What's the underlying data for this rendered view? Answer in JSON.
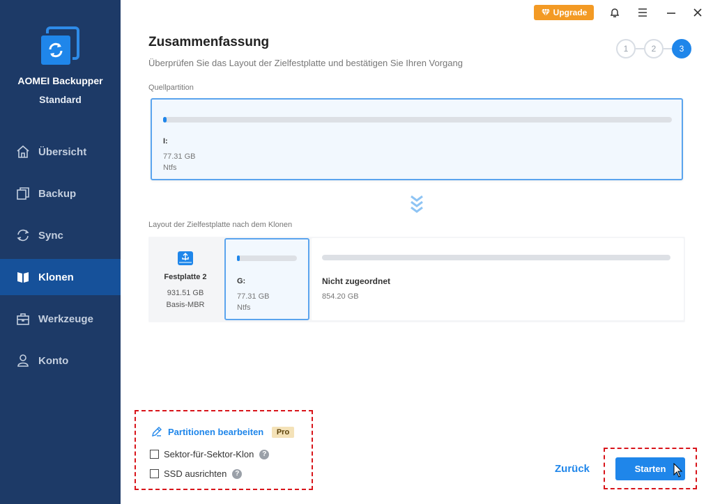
{
  "app": {
    "name": "AOMEI Backupper",
    "edition": "Standard"
  },
  "sidebar": {
    "items": [
      {
        "label": "Übersicht",
        "icon": "home-icon"
      },
      {
        "label": "Backup",
        "icon": "backup-icon"
      },
      {
        "label": "Sync",
        "icon": "sync-icon"
      },
      {
        "label": "Klonen",
        "icon": "clone-icon",
        "active": true
      },
      {
        "label": "Werkzeuge",
        "icon": "toolbox-icon"
      },
      {
        "label": "Konto",
        "icon": "user-icon"
      }
    ]
  },
  "titlebar": {
    "upgrade_label": "Upgrade"
  },
  "header": {
    "title": "Zusammenfassung",
    "subtitle": "Überprüfen Sie das Layout der Zielfestplatte und bestätigen Sie Ihren Vorgang",
    "steps": [
      "1",
      "2",
      "3"
    ],
    "active_step": 3
  },
  "source": {
    "label": "Quellpartition",
    "letter": "I:",
    "size": "77.31 GB",
    "fs": "Ntfs",
    "used_fraction": 0.005
  },
  "destination": {
    "label": "Layout der Zielfestplatte nach dem Klonen",
    "disk_name": "Festplatte 2",
    "disk_size": "931.51 GB",
    "disk_type": "Basis-MBR",
    "partition": {
      "letter": "G:",
      "size": "77.31 GB",
      "fs": "Ntfs",
      "used_fraction": 0.04
    },
    "unallocated": {
      "label": "Nicht zugeordnet",
      "size": "854.20 GB"
    }
  },
  "options": {
    "edit_label": "Partitionen bearbeiten",
    "pro_label": "Pro",
    "sector_label": "Sektor-für-Sektor-Klon",
    "ssd_label": "SSD ausrichten",
    "help_glyph": "?"
  },
  "buttons": {
    "back_label": "Zurück",
    "start_label": "Starten"
  },
  "colors": {
    "sidebar": "#1d3a67",
    "sidebar_active": "#16519a",
    "accent": "#1f86ea",
    "upgrade": "#f39a24",
    "highlight_dash": "#d8141a"
  }
}
